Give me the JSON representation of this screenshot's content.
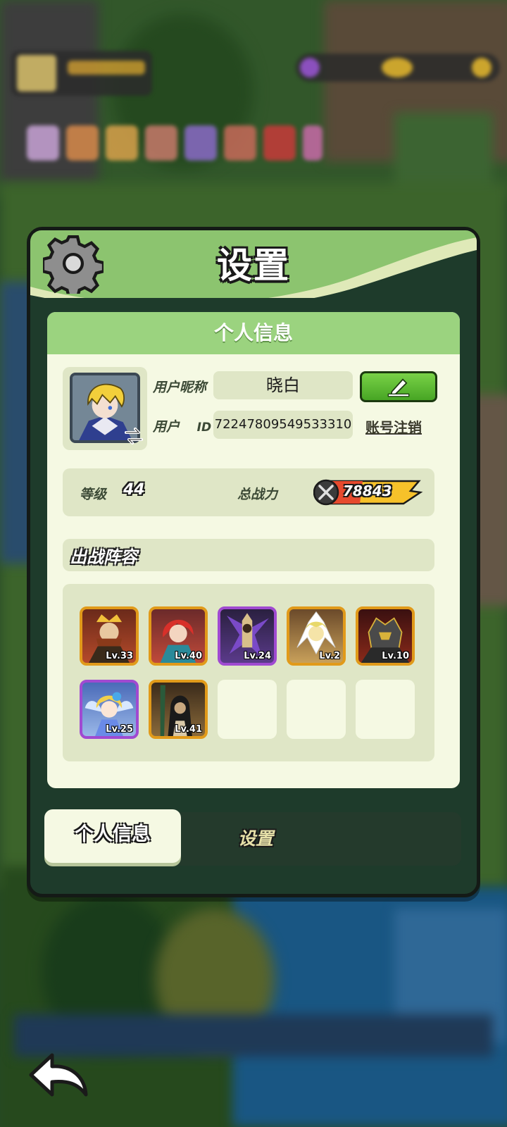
{
  "dialog": {
    "title": "设置",
    "gear_icon": "gear-icon"
  },
  "profile": {
    "section_title": "个人信息",
    "nickname_label": "用户昵称",
    "nickname_value": "晓白",
    "id_label": "用户",
    "id_label_suffix": "ID",
    "id_value": "72247809549533310",
    "logout_label": "账号注销",
    "edit_icon": "pencil-icon"
  },
  "stats": {
    "level_label": "等级",
    "level_value": "44",
    "power_label": "总战力",
    "power_value": "78843"
  },
  "lineup": {
    "title": "出战阵容",
    "heroes": [
      {
        "level": "Lv.33",
        "rarity": "orange"
      },
      {
        "level": "Lv.40",
        "rarity": "orange"
      },
      {
        "level": "Lv.24",
        "rarity": "purple"
      },
      {
        "level": "Lv.2",
        "rarity": "orange"
      },
      {
        "level": "Lv.10",
        "rarity": "orange"
      },
      {
        "level": "Lv.25",
        "rarity": "purple"
      },
      {
        "level": "Lv.41",
        "rarity": "orange"
      }
    ],
    "empty_slots": 3
  },
  "tabs": {
    "active": "个人信息",
    "other": "设置"
  },
  "colors": {
    "header_green": "#8cc46f",
    "panel_bg": "#f5f9e3",
    "field_bg": "#dfe6c6",
    "edit_button": "#5cbd33",
    "orange_frame": "#e19a1a",
    "purple_frame": "#a04ad1"
  }
}
